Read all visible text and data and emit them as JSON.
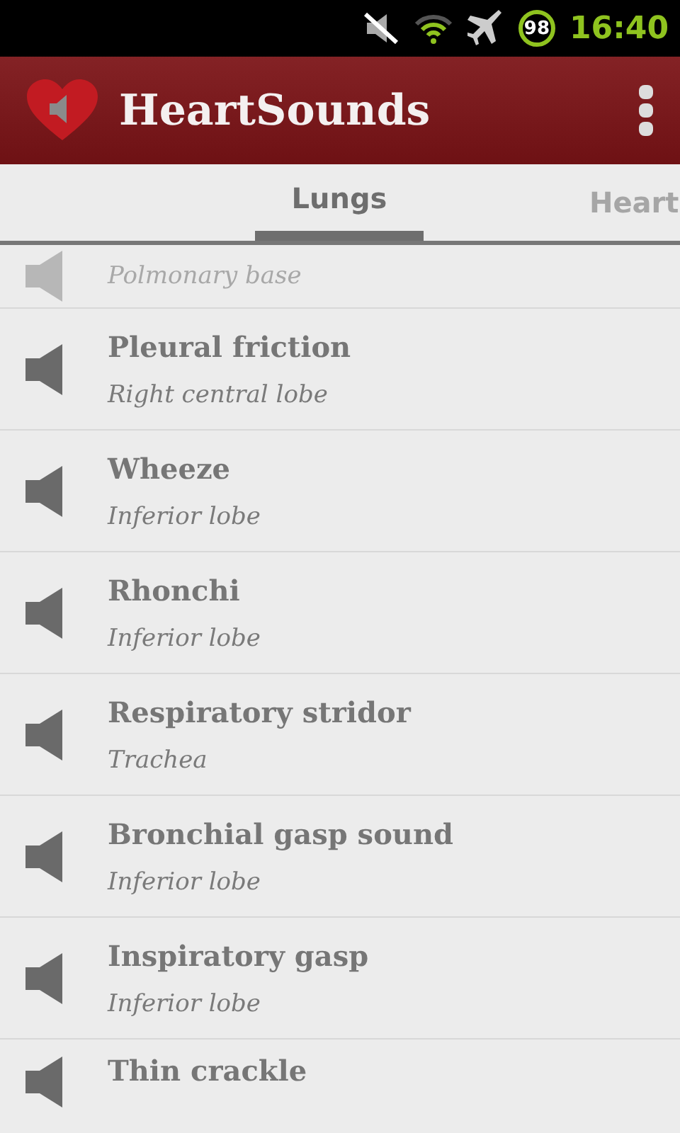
{
  "status_bar": {
    "battery": "98",
    "time": "16:40"
  },
  "app_bar": {
    "title": "HeartSounds"
  },
  "tabs": [
    {
      "label": "Lungs",
      "selected": true
    },
    {
      "label": "Heart",
      "selected": false
    }
  ],
  "items": [
    {
      "kind": "top-cut",
      "subtitle": "Polmonary base"
    },
    {
      "kind": "full",
      "title": "Pleural friction",
      "subtitle": "Right central lobe"
    },
    {
      "kind": "full",
      "title": "Wheeze",
      "subtitle": "Inferior lobe"
    },
    {
      "kind": "full",
      "title": "Rhonchi",
      "subtitle": "Inferior lobe"
    },
    {
      "kind": "full",
      "title": "Respiratory stridor",
      "subtitle": "Trachea"
    },
    {
      "kind": "full",
      "title": "Bronchial gasp sound",
      "subtitle": "Inferior lobe"
    },
    {
      "kind": "full",
      "title": "Inspiratory gasp",
      "subtitle": "Inferior lobe"
    },
    {
      "kind": "bottom-cut",
      "title": "Thin crackle"
    }
  ]
}
